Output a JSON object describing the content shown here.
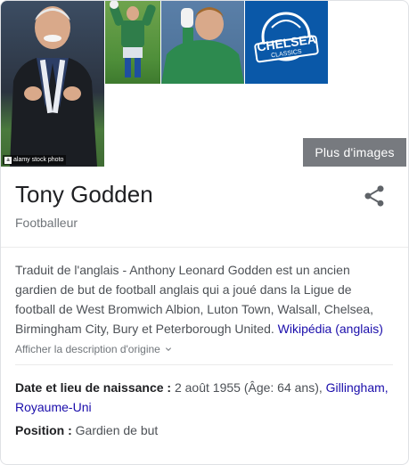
{
  "gallery": {
    "watermark": "alamy stock photo",
    "watermark_logo": "a",
    "badge_top": "CHELSEA",
    "badge_bottom": "CLASSICS",
    "more_images": "Plus d'images"
  },
  "header": {
    "title": "Tony Godden",
    "subtitle": "Footballeur",
    "share_icon": "share-icon"
  },
  "description": {
    "text": "Traduit de l'anglais - Anthony Leonard Godden est un ancien gardien de but de football anglais qui a joué dans la Ligue de football de West Bromwich Albion, Luton Town, Walsall, Chelsea, Birmingham City, Bury et Peterborough United.",
    "source_link": "Wikipédia (anglais)",
    "show_original": "Afficher la description d'origine"
  },
  "facts": {
    "birth": {
      "label": "Date et lieu de naissance :",
      "value": "2 août 1955 (Âge: 64 ans),",
      "place_link": "Gillingham, Royaume-Uni"
    },
    "position": {
      "label": "Position :",
      "value": "Gardien de but"
    }
  },
  "colors": {
    "link": "#1a0dab",
    "text": "#202124",
    "muted": "#70757a",
    "badge_blue": "#0a58a8"
  }
}
